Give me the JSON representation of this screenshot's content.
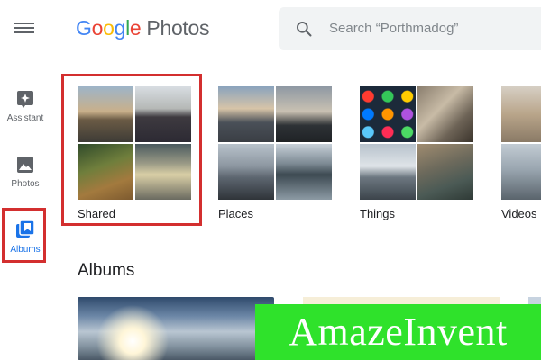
{
  "header": {
    "logo_parts": [
      "G",
      "o",
      "o",
      "g",
      "l",
      "e"
    ],
    "logo_product": "Photos",
    "search_placeholder": "Search “Porthmadog”"
  },
  "sidebar": {
    "items": [
      {
        "label": "Assistant",
        "icon": "assistant-icon"
      },
      {
        "label": "Photos",
        "icon": "photo-icon"
      },
      {
        "label": "Albums",
        "icon": "albums-icon",
        "active": true
      }
    ]
  },
  "categories": [
    {
      "label": "Shared"
    },
    {
      "label": "Places"
    },
    {
      "label": "Things"
    },
    {
      "label": "Videos"
    }
  ],
  "albums_section": {
    "title": "Albums"
  },
  "watermark": "AmazeInvent",
  "colors": {
    "accent": "#1a73e8",
    "highlight_box": "#d32f2f",
    "watermark_bg": "#2fe22b"
  }
}
